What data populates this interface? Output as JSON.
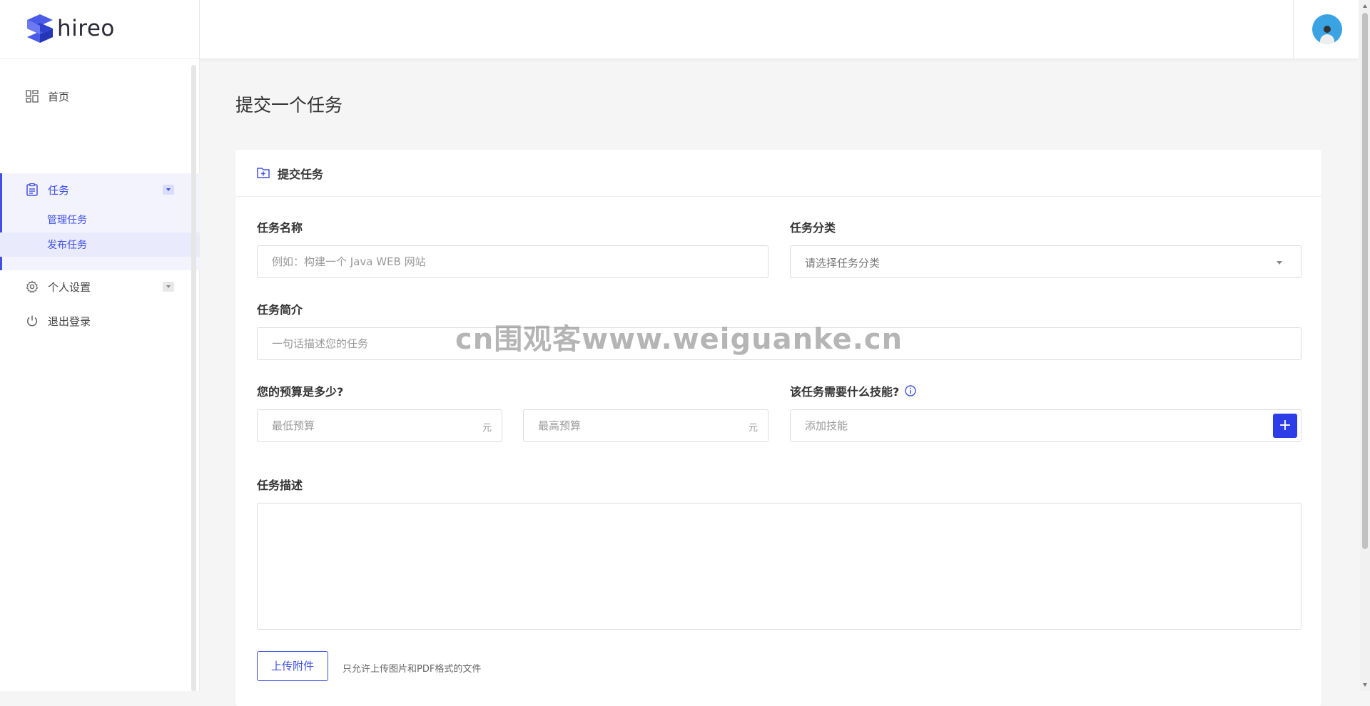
{
  "brand": {
    "name": "hireo"
  },
  "sidebar": {
    "items": [
      {
        "label": "首页",
        "icon": "dashboard-icon"
      },
      {
        "label": "任务",
        "icon": "clipboard-icon"
      },
      {
        "label": "个人设置",
        "icon": "gear-icon"
      },
      {
        "label": "退出登录",
        "icon": "power-icon"
      }
    ],
    "task_subitems": [
      {
        "label": "管理任务"
      },
      {
        "label": "发布任务"
      }
    ]
  },
  "page": {
    "title": "提交一个任务"
  },
  "form": {
    "header": "提交任务",
    "name_label": "任务名称",
    "name_placeholder": "例如：构建一个 Java WEB 网站",
    "category_label": "任务分类",
    "category_placeholder": "请选择任务分类",
    "intro_label": "任务简介",
    "intro_placeholder": "一句话描述您的任务",
    "budget_label": "您的预算是多少?",
    "budget_min_placeholder": "最低预算",
    "budget_max_placeholder": "最高预算",
    "currency_suffix": "元",
    "skills_label": "该任务需要什么技能?",
    "skills_placeholder": "添加技能",
    "skills_add": "+",
    "desc_label": "任务描述",
    "desc_value": "",
    "upload_label": "上传附件",
    "upload_hint": "只允许上传图片和PDF格式的文件"
  },
  "watermark": "cn围观客www.weiguanke.cn",
  "colors": {
    "accent": "#3f51e6",
    "button": "#2d3de8"
  }
}
